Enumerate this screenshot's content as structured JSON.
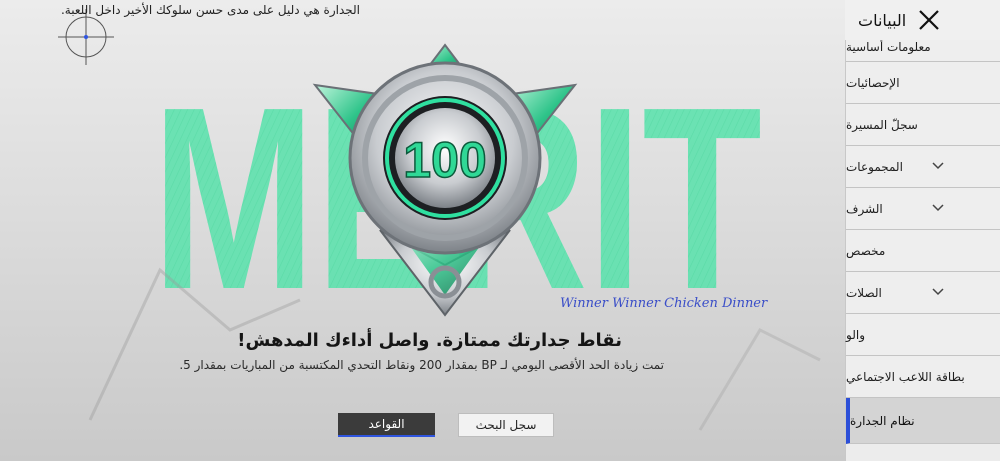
{
  "hint_text": "الجدارة هي دليل على مدى حسن سلوكك الأخير داخل اللعبة.",
  "panel": {
    "title": "البيانات"
  },
  "sidebar": {
    "items": [
      {
        "label": "معلومات أساسية",
        "has_chevron": false,
        "active": false
      },
      {
        "label": "الإحصائيات",
        "has_chevron": false,
        "active": false
      },
      {
        "label": "سجلّ المسيرة",
        "has_chevron": false,
        "active": false
      },
      {
        "label": "المجموعات",
        "has_chevron": true,
        "active": false
      },
      {
        "label": "الشرف",
        "has_chevron": true,
        "active": false
      },
      {
        "label": "مخصص",
        "has_chevron": false,
        "active": false
      },
      {
        "label": "الصلات",
        "has_chevron": true,
        "active": false
      },
      {
        "label": "والو",
        "has_chevron": false,
        "active": false
      },
      {
        "label": "بطاقة اللاعب الاجتماعي",
        "has_chevron": false,
        "active": false
      },
      {
        "label": "نظام الجدارة",
        "has_chevron": false,
        "active": true
      }
    ]
  },
  "background_word": "MERIT",
  "medal": {
    "score": "100"
  },
  "signature": "Winner Winner Chicken Dinner",
  "main": {
    "headline": "نقاط جدارتك ممتازة. واصل أداءك المدهش!",
    "subline": "تمت زيادة الحد الأقصى اليومي لـ BP بمقدار 200 ونقاط التحدي المكتسبة من المباريات بمقدار 5."
  },
  "buttons": {
    "rules": "القواعد",
    "history": "سجل البحث"
  },
  "colors": {
    "accent_green": "#4fe0a4",
    "active_blue": "#2f55e0"
  }
}
